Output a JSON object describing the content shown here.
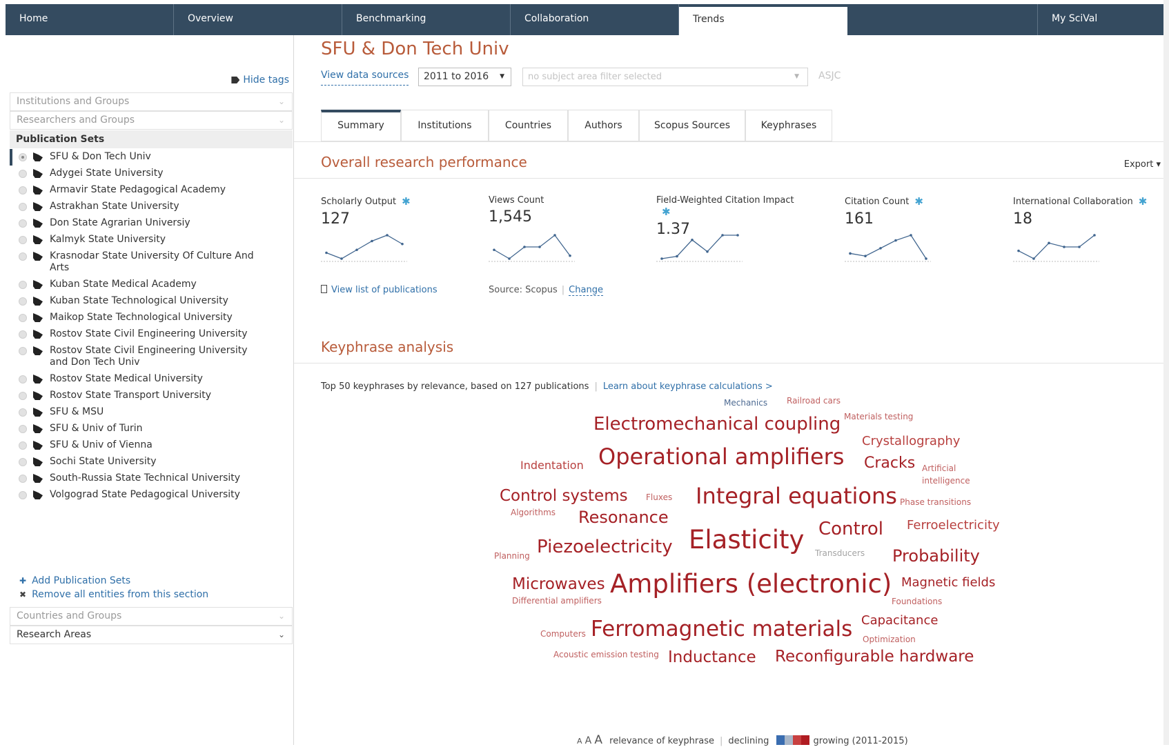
{
  "nav": {
    "tabs": [
      {
        "label": "Home"
      },
      {
        "label": "Overview"
      },
      {
        "label": "Benchmarking"
      },
      {
        "label": "Collaboration"
      },
      {
        "label": "Trends"
      },
      {
        "label": "My SciVal"
      }
    ],
    "active": "Trends"
  },
  "sidebar": {
    "hide_tags": "Hide tags",
    "sections": {
      "institutions": "Institutions and Groups",
      "researchers": "Researchers and Groups",
      "publication_sets": "Publication Sets",
      "countries": "Countries and Groups",
      "research_areas": "Research Areas"
    },
    "publication_sets": [
      {
        "label": "SFU & Don Tech Univ",
        "selected": true
      },
      {
        "label": "Adygei State University"
      },
      {
        "label": "Armavir State Pedagogical Academy"
      },
      {
        "label": "Astrakhan State University"
      },
      {
        "label": "Don State Agrarian Universiy"
      },
      {
        "label": "Kalmyk State University"
      },
      {
        "label": "Krasnodar State University Of Culture And Arts"
      },
      {
        "label": "Kuban State Medical Academy"
      },
      {
        "label": "Kuban State Technological University"
      },
      {
        "label": "Maikop State Technological University"
      },
      {
        "label": "Rostov State Civil Engineering University"
      },
      {
        "label": "Rostov State Civil Engineering University and Don Tech Univ"
      },
      {
        "label": "Rostov State Medical University"
      },
      {
        "label": "Rostov State Transport University"
      },
      {
        "label": "SFU & MSU"
      },
      {
        "label": "SFU & Univ of Turin"
      },
      {
        "label": "SFU & Univ of Vienna"
      },
      {
        "label": "Sochi State University"
      },
      {
        "label": "South-Russia State Technical University"
      },
      {
        "label": "Volgograd State Pedagogical University"
      }
    ],
    "add_label": "Add Publication Sets",
    "remove_label": "Remove all entities from this section"
  },
  "main": {
    "title": "SFU & Don Tech Univ",
    "view_sources": "View data sources",
    "year_range": "2011 to 2016",
    "subject_placeholder": "no subject area filter selected",
    "asjc": "ASJC",
    "subtabs": [
      "Summary",
      "Institutions",
      "Countries",
      "Authors",
      "Scopus Sources",
      "Keyphrases"
    ],
    "active_subtab": "Summary",
    "overall_title": "Overall research performance",
    "export": "Export",
    "metrics": [
      {
        "label": "Scholarly Output",
        "value": "127",
        "gear": true,
        "trend": [
          3,
          1,
          4,
          7,
          9,
          6
        ]
      },
      {
        "label": "Views Count",
        "value": "1,545",
        "gear": false,
        "trend": [
          5,
          2,
          6,
          6,
          10,
          3
        ]
      },
      {
        "label": "Field-Weighted Citation Impact",
        "value": "1.37",
        "gear": true,
        "trend": [
          1,
          2,
          9,
          4,
          11,
          11
        ]
      },
      {
        "label": "Citation Count",
        "value": "161",
        "gear": true,
        "trend": [
          3,
          2,
          5,
          8,
          10,
          1
        ]
      },
      {
        "label": "International Collaboration",
        "value": "18",
        "gear": true,
        "trend": [
          4,
          2,
          6,
          5,
          5,
          8
        ]
      }
    ],
    "view_list": "View list of publications",
    "source_label": "Source: Scopus",
    "change_label": "Change",
    "keyphrase_title": "Keyphrase analysis",
    "keyphrase_info": "Top 50 keyphrases by relevance, based on 127 publications",
    "keyphrase_link": "Learn about keyphrase calculations >",
    "keyphrases": [
      {
        "text": "Mechanics",
        "tone": "c4"
      },
      {
        "text": "Railroad cars",
        "tone": "c3"
      },
      {
        "text": "Electromechanical coupling",
        "tone": "c1"
      },
      {
        "text": "Materials testing",
        "tone": "c3"
      },
      {
        "text": "Crystallography",
        "tone": "c2"
      },
      {
        "text": "Indentation",
        "tone": "c2"
      },
      {
        "text": "Operational amplifiers",
        "tone": "c1"
      },
      {
        "text": "Cracks",
        "tone": "c1"
      },
      {
        "text": "Artificial",
        "tone": "c3"
      },
      {
        "text": "intelligence",
        "tone": "c3"
      },
      {
        "text": "Control systems",
        "tone": "c1"
      },
      {
        "text": "Fluxes",
        "tone": "c3"
      },
      {
        "text": "Integral equations",
        "tone": "c1"
      },
      {
        "text": "Phase transitions",
        "tone": "c3"
      },
      {
        "text": "Algorithms",
        "tone": "c3"
      },
      {
        "text": "Resonance",
        "tone": "c1"
      },
      {
        "text": "Control",
        "tone": "c1"
      },
      {
        "text": "Ferroelectricity",
        "tone": "c2"
      },
      {
        "text": "Planning",
        "tone": "c3"
      },
      {
        "text": "Piezoelectricity",
        "tone": "c1"
      },
      {
        "text": "Elasticity",
        "tone": "c1"
      },
      {
        "text": "Transducers",
        "tone": "c5"
      },
      {
        "text": "Probability",
        "tone": "c1"
      },
      {
        "text": "Microwaves",
        "tone": "c1"
      },
      {
        "text": "Amplifiers (electronic)",
        "tone": "c1"
      },
      {
        "text": "Magnetic fields",
        "tone": "c1"
      },
      {
        "text": "Differential amplifiers",
        "tone": "c3"
      },
      {
        "text": "Foundations",
        "tone": "c3"
      },
      {
        "text": "Capacitance",
        "tone": "c1"
      },
      {
        "text": "Computers",
        "tone": "c3"
      },
      {
        "text": "Ferromagnetic materials",
        "tone": "c1"
      },
      {
        "text": "Optimization",
        "tone": "c3"
      },
      {
        "text": "Acoustic emission testing",
        "tone": "c3"
      },
      {
        "text": "Inductance",
        "tone": "c1"
      },
      {
        "text": "Reconfigurable hardware",
        "tone": "c1"
      }
    ],
    "legend": {
      "aaa": [
        "A",
        "A",
        "A"
      ],
      "relevance": "relevance of keyphrase",
      "declining": "declining",
      "growing": "growing (2011-2015)",
      "colors": [
        "#3a6db0",
        "#a8b6c8",
        "#c84040",
        "#b01c22"
      ]
    }
  }
}
